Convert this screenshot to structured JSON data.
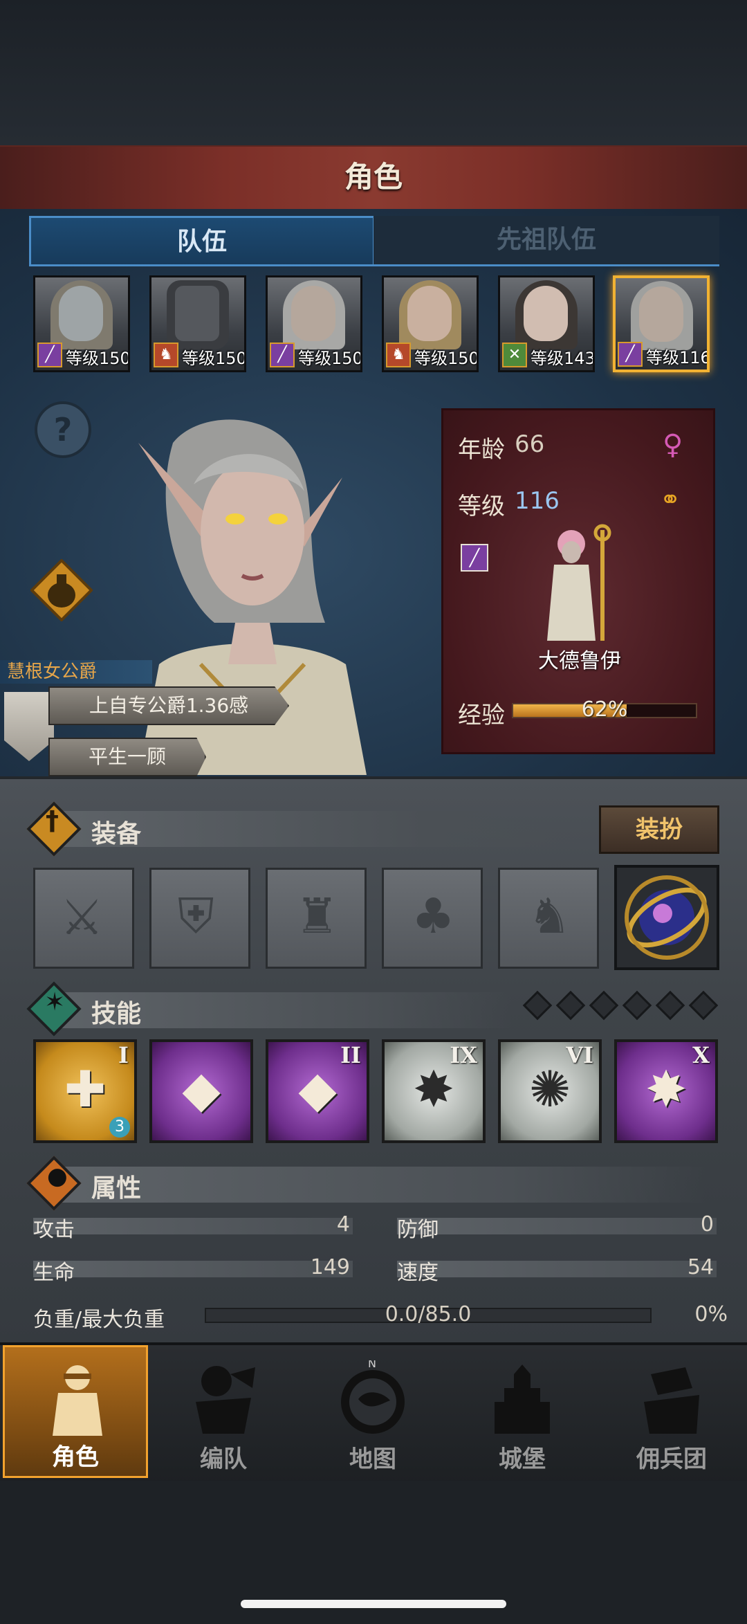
{
  "header": {
    "title": "角色"
  },
  "tabs": [
    {
      "label": "队伍",
      "active": true
    },
    {
      "label": "先祖队伍",
      "active": false
    }
  ],
  "roster": [
    {
      "level_text": "等级150",
      "class_icon": "staff-icon",
      "badge_color": "#7a3fa0"
    },
    {
      "level_text": "等级150",
      "class_icon": "helmet-icon",
      "badge_color": "#b5482a"
    },
    {
      "level_text": "等级150",
      "class_icon": "staff-icon",
      "badge_color": "#7a3fa0"
    },
    {
      "level_text": "等级150",
      "class_icon": "helmet-icon",
      "badge_color": "#b5482a"
    },
    {
      "level_text": "等级143",
      "class_icon": "crossed-swords-icon",
      "badge_color": "#4f8a3a"
    },
    {
      "level_text": "等级116",
      "class_icon": "staff-icon",
      "badge_color": "#7a3fa0",
      "selected": true
    }
  ],
  "character": {
    "trait_title": "慧根女公爵",
    "trait_line1": "上自专公爵1.36感",
    "trait_line2": "平生一顾",
    "age_label": "年龄",
    "age": "66",
    "level_label": "等级",
    "level": "116",
    "class_name": "大德鲁伊",
    "exp_label": "经验",
    "exp_text": "62%",
    "exp_fraction": 0.62
  },
  "equipment": {
    "title": "装备",
    "dress_button": "装扮",
    "slots": [
      "sword-icon",
      "shield-icon",
      "helmet-icon",
      "armor-icon",
      "boots-icon",
      "astrolabe-icon"
    ]
  },
  "skills": {
    "title": "技能",
    "gem_count": 6,
    "items": [
      {
        "rank": "I",
        "glyph": "✚",
        "style": "gold",
        "badge": "3"
      },
      {
        "rank": "",
        "glyph": "◆",
        "style": "purple"
      },
      {
        "rank": "II",
        "glyph": "◆",
        "style": "purple"
      },
      {
        "rank": "IX",
        "glyph": "✸",
        "style": "gray"
      },
      {
        "rank": "VI",
        "glyph": "✺",
        "style": "gray"
      },
      {
        "rank": "X",
        "glyph": "✸",
        "style": "purple"
      }
    ]
  },
  "attributes": {
    "title": "属性",
    "attack_label": "攻击",
    "attack": "4",
    "defense_label": "防御",
    "defense": "0",
    "hp_label": "生命",
    "hp": "149",
    "speed_label": "速度",
    "speed": "54",
    "load_label": "负重/最大负重",
    "load": "0.0/85.0",
    "load_pct": "0%"
  },
  "nav": [
    {
      "label": "角色",
      "active": true,
      "icon": "knight-icon"
    },
    {
      "label": "编队",
      "active": false,
      "icon": "formation-icon"
    },
    {
      "label": "地图",
      "active": false,
      "icon": "compass-map-icon"
    },
    {
      "label": "城堡",
      "active": false,
      "icon": "castle-icon"
    },
    {
      "label": "佣兵团",
      "active": false,
      "icon": "mercenary-icon"
    }
  ],
  "colors": {
    "accent_gold": "#f1b233",
    "tab_blue": "#4b8dc8",
    "banner_red": "#7b2f28"
  }
}
